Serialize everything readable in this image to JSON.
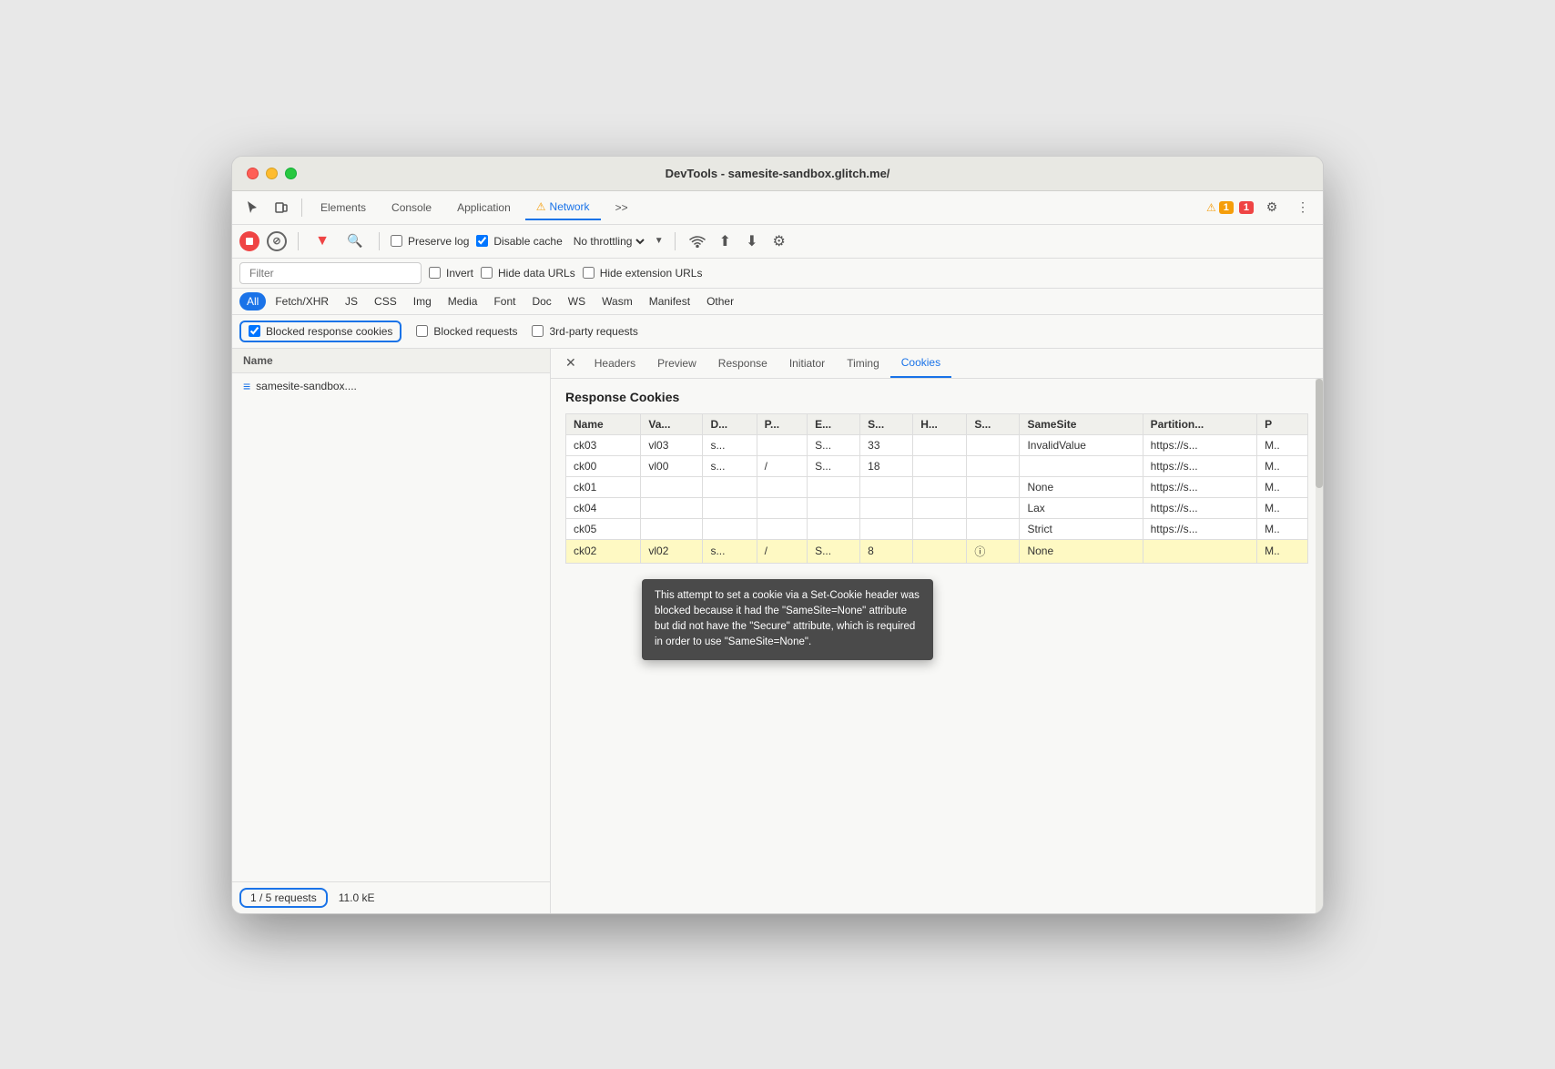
{
  "window": {
    "title": "DevTools - samesite-sandbox.glitch.me/"
  },
  "tabs": {
    "items": [
      "Elements",
      "Console",
      "Application",
      "Network",
      ">>"
    ],
    "active": "Network"
  },
  "toolbar": {
    "warn_count": "1",
    "err_count": "1"
  },
  "toolbar2": {
    "preserve_log": "Preserve log",
    "disable_cache": "Disable cache",
    "throttle": "No throttling"
  },
  "filter_bar": {
    "filter_placeholder": "Filter",
    "invert_label": "Invert",
    "hide_data_urls_label": "Hide data URLs",
    "hide_ext_urls_label": "Hide extension URLs"
  },
  "type_bar": {
    "items": [
      "All",
      "Fetch/XHR",
      "JS",
      "CSS",
      "Img",
      "Media",
      "Font",
      "Doc",
      "WS",
      "Wasm",
      "Manifest",
      "Other"
    ],
    "active": "All"
  },
  "checkbox_bar": {
    "blocked_response_cookies": "Blocked response cookies",
    "blocked_requests": "Blocked requests",
    "third_party_requests": "3rd-party requests"
  },
  "requests": {
    "header": "Name",
    "items": [
      {
        "name": "samesite-sandbox...."
      }
    ]
  },
  "status_bar": {
    "requests": "1 / 5 requests",
    "size": "11.0 kE"
  },
  "detail": {
    "tabs": [
      "Headers",
      "Preview",
      "Response",
      "Initiator",
      "Timing",
      "Cookies"
    ],
    "active": "Cookies",
    "cookies_title": "Response Cookies",
    "table_headers": [
      "Name",
      "Va...",
      "D...",
      "P...",
      "E...",
      "S...",
      "H...",
      "S...",
      "SameSite",
      "Partition...",
      "P"
    ],
    "rows": [
      {
        "name": "ck03",
        "va": "vl03",
        "d": "s...",
        "p": "",
        "e": "S...",
        "s": "33",
        "h": "",
        "s2": "",
        "samesite": "InvalidValue",
        "partition": "https://s...",
        "p2": "M..",
        "highlight": false
      },
      {
        "name": "ck00",
        "va": "vl00",
        "d": "s...",
        "p": "/",
        "e": "S...",
        "s": "18",
        "h": "",
        "s2": "",
        "samesite": "",
        "partition": "https://s...",
        "p2": "M..",
        "highlight": false
      },
      {
        "name": "ck01",
        "va": "",
        "d": "",
        "p": "",
        "e": "",
        "s": "",
        "h": "",
        "s2": "",
        "samesite": "None",
        "partition": "https://s...",
        "p2": "M..",
        "highlight": false
      },
      {
        "name": "ck04",
        "va": "",
        "d": "",
        "p": "",
        "e": "",
        "s": "",
        "h": "",
        "s2": "",
        "samesite": "Lax",
        "partition": "https://s...",
        "p2": "M..",
        "highlight": false
      },
      {
        "name": "ck05",
        "va": "",
        "d": "",
        "p": "",
        "e": "",
        "s": "",
        "h": "",
        "s2": "",
        "samesite": "Strict",
        "partition": "https://s...",
        "p2": "M..",
        "highlight": false
      },
      {
        "name": "ck02",
        "va": "vl02",
        "d": "s...",
        "p": "/",
        "e": "S...",
        "s": "8",
        "h": "",
        "s2": "ⓘ",
        "samesite": "None",
        "partition": "",
        "p2": "M..",
        "highlight": true
      }
    ],
    "tooltip": "This attempt to set a cookie via a Set-Cookie header was blocked because it had the \"SameSite=None\" attribute but did not have the \"Secure\" attribute, which is required in order to use \"SameSite=None\"."
  }
}
